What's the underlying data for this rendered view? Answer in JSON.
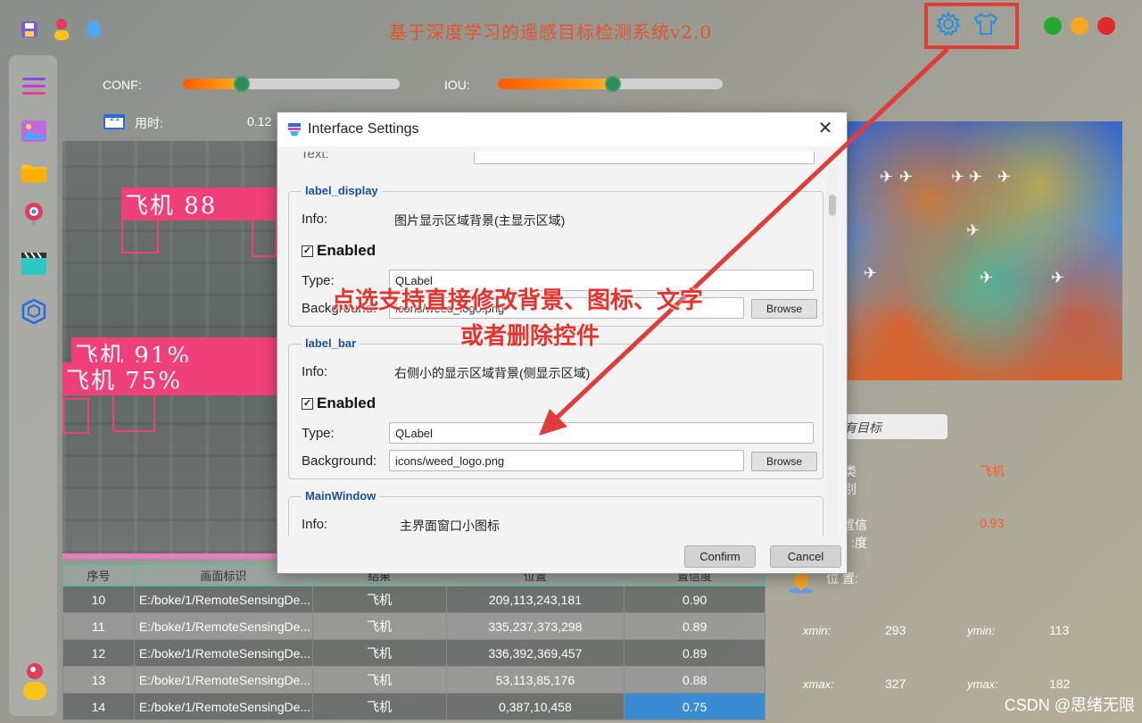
{
  "app": {
    "title": "基于深度学习的遥感目标检测系统v2.0"
  },
  "sliders": {
    "conf_label": "CONF:",
    "conf_value": 0.27,
    "iou_label": "IOU:",
    "iou_value": 0.51
  },
  "stats": {
    "time_label": "用时:",
    "time_value": "0.12",
    "calendar_num": "21"
  },
  "detections": [
    {
      "label": "飞机 88"
    },
    {
      "label": "飞机 91%"
    },
    {
      "label": "飞机 75%"
    }
  ],
  "right_panel": {
    "target_select": "有目标",
    "class_label": "类别:",
    "class_value": "飞机",
    "conf_label": "置信度:",
    "conf_value": "0.93",
    "position_label": "位 置:",
    "xmin_label": "xmin:",
    "xmin": "293",
    "ymin_label": "ymin:",
    "ymin": "113",
    "xmax_label": "xmax:",
    "xmax": "327",
    "ymax_label": "ymax:",
    "ymax": "182"
  },
  "table": {
    "headers": [
      "序号",
      "画面标识",
      "结果",
      "位置",
      "置信度"
    ],
    "rows": [
      {
        "id": "10",
        "path": "E:/boke/1/RemoteSensingDe...",
        "result": "飞机",
        "pos": "209,113,243,181",
        "conf": "0.90"
      },
      {
        "id": "11",
        "path": "E:/boke/1/RemoteSensingDe...",
        "result": "飞机",
        "pos": "335,237,373,298",
        "conf": "0.89"
      },
      {
        "id": "12",
        "path": "E:/boke/1/RemoteSensingDe...",
        "result": "飞机",
        "pos": "336,392,369,457",
        "conf": "0.89"
      },
      {
        "id": "13",
        "path": "E:/boke/1/RemoteSensingDe...",
        "result": "飞机",
        "pos": "53,113,85,176",
        "conf": "0.88"
      },
      {
        "id": "14",
        "path": "E:/boke/1/RemoteSensingDe...",
        "result": "飞机",
        "pos": "0,387,10,458",
        "conf": "0.75"
      }
    ]
  },
  "dialog": {
    "title": "Interface Settings",
    "top_partial_label": "Text:",
    "groups": [
      {
        "name": "label_display",
        "info_label": "Info:",
        "info": "图片显示区域背景(主显示区域)",
        "enabled_label": "Enabled",
        "type_label": "Type:",
        "type": "QLabel",
        "bg_label": "Background:",
        "bg": "icons/weed_logo.png",
        "browse": "Browse"
      },
      {
        "name": "label_bar",
        "info_label": "Info:",
        "info": "右侧小的显示区域背景(侧显示区域)",
        "enabled_label": "Enabled",
        "type_label": "Type:",
        "type": "QLabel",
        "bg_label": "Background:",
        "bg": "icons/weed_logo.png",
        "browse": "Browse"
      },
      {
        "name": "MainWindow",
        "info_label": "Info:",
        "info": "主界面窗口小图标"
      }
    ],
    "confirm": "Confirm",
    "cancel": "Cancel"
  },
  "annotation": {
    "line1": "点选支持直接修改背景、图标、文字",
    "line2": "或者删除控件"
  },
  "watermark": "CSDN @思绪无限",
  "colors": {
    "accent_red": "#e03c3c",
    "title_orange": "#e6532a",
    "detection_pink": "#f0407a",
    "selected_blue": "#3b8bd4"
  }
}
